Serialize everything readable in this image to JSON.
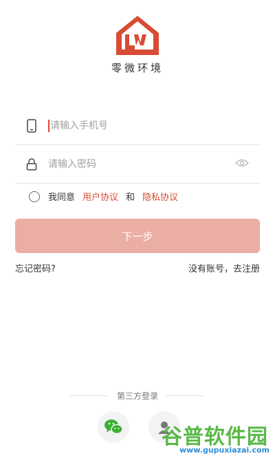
{
  "brand": {
    "app_name": "零微环境",
    "logo_color": "#d94b34"
  },
  "login": {
    "phone_placeholder": "请输入手机号",
    "password_placeholder": "请输入密码",
    "agree_prefix": "我同意",
    "user_agreement": "用户协议",
    "and": "和",
    "privacy_policy": "隐私协议",
    "next_button": "下一步",
    "forgot_password": "忘记密码?",
    "register": "没有账号，去注册"
  },
  "third_party": {
    "label": "第三方登录",
    "wechat_color": "#3cb034"
  },
  "watermark": {
    "main": "谷普软件园",
    "sub": "www.gupuxiazai.com"
  },
  "colors": {
    "accent": "#d94b34",
    "button_disabled": "#ebaea4"
  },
  "icons": [
    "logo-icon",
    "phone-icon",
    "lock-icon",
    "eye-icon",
    "wechat-icon",
    "user-icon"
  ]
}
